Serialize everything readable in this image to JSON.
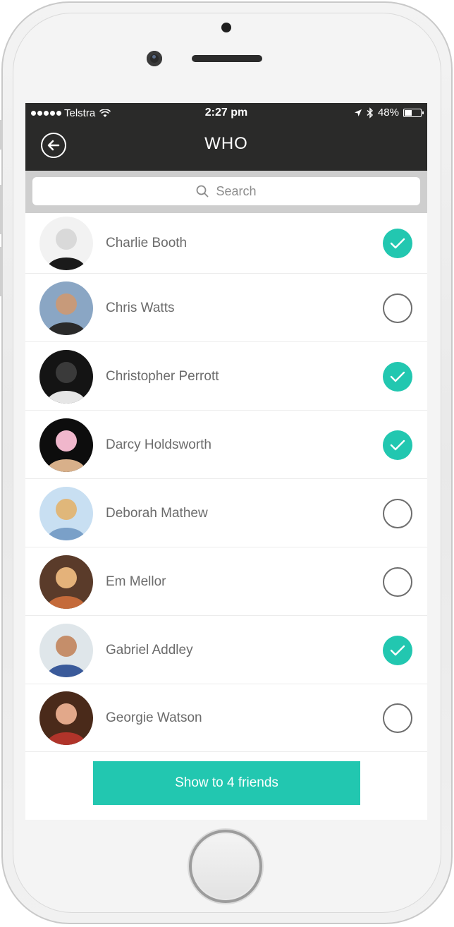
{
  "status_bar": {
    "carrier": "Telstra",
    "time": "2:27 pm",
    "battery": "48%",
    "battery_level": 0.48
  },
  "nav": {
    "title": "WHO",
    "back_icon": "back-arrow-circle-icon"
  },
  "search": {
    "placeholder": "Search",
    "icon": "search-icon"
  },
  "friends": [
    {
      "name": "Charlie Booth",
      "selected": true
    },
    {
      "name": "Chris Watts",
      "selected": false
    },
    {
      "name": "Christopher Perrott",
      "selected": true
    },
    {
      "name": "Darcy Holdsworth",
      "selected": true
    },
    {
      "name": "Deborah Mathew",
      "selected": false
    },
    {
      "name": "Em Mellor",
      "selected": false
    },
    {
      "name": "Gabriel Addley",
      "selected": true
    },
    {
      "name": "Georgie Watson",
      "selected": false
    }
  ],
  "action_button": {
    "label": "Show to 4 friends"
  },
  "colors": {
    "accent": "#22c7b0",
    "header": "#2a2a29",
    "search_bg": "#cecece",
    "name_text": "#6b6b6b"
  }
}
